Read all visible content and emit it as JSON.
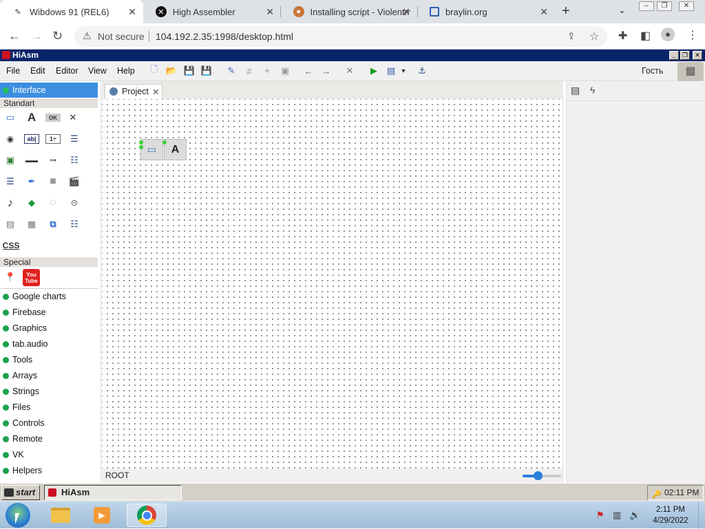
{
  "browser": {
    "tabs": [
      {
        "title": "Wibdows 91 (REL6)",
        "active": true
      },
      {
        "title": "High Assembler",
        "active": false
      },
      {
        "title": "Installing script - Violentm",
        "active": false
      },
      {
        "title": "braylin.org",
        "active": false
      }
    ],
    "security_label": "Not secure",
    "url": "104.192.2.35:1998/desktop.html"
  },
  "app": {
    "title": "HiAsm",
    "menu": [
      "File",
      "Edit",
      "Editor",
      "View",
      "Help"
    ],
    "user_label": "Гость"
  },
  "palette": {
    "interface_label": "Interface",
    "standart_label": "Standart",
    "css_label": "CSS",
    "special_label": "Special",
    "groups": [
      "Google charts",
      "Firebase",
      "Graphics",
      "tab.audio",
      "Tools",
      "Arrays",
      "Strings",
      "Files",
      "Controls",
      "Remote",
      "VK",
      "Helpers"
    ]
  },
  "workspace": {
    "tab_label": "Project",
    "status_text": "ROOT",
    "zoom_level": 0.4
  },
  "taskbar": {
    "start_label": "start",
    "task_label": "HiAsm",
    "tray_time": "02:11 PM"
  },
  "windows": {
    "clock_time": "2:11 PM",
    "clock_date": "4/29/2022"
  },
  "colors": {
    "accent": "#3c8ee0",
    "group_dot": "#1ba34a",
    "title_bar": "#0a246a"
  }
}
